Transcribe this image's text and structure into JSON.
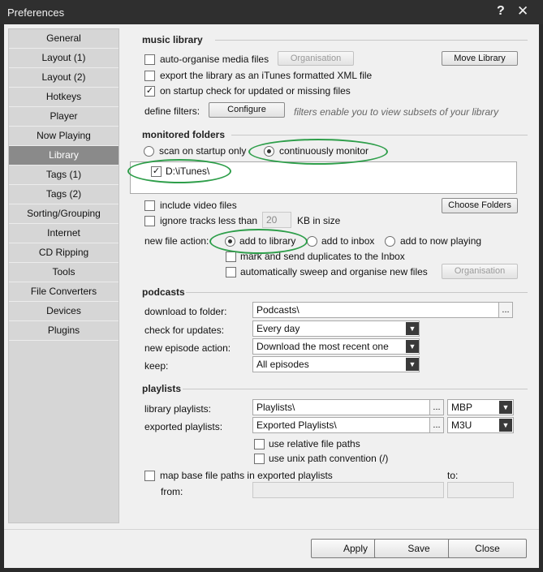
{
  "window": {
    "title": "Preferences",
    "help_glyph": "?",
    "close_glyph": "✕"
  },
  "nav": {
    "items": [
      "General",
      "Layout (1)",
      "Layout (2)",
      "Hotkeys",
      "Player",
      "Now Playing",
      "Library",
      "Tags (1)",
      "Tags (2)",
      "Sorting/Grouping",
      "Internet",
      "CD Ripping",
      "Tools",
      "File Converters",
      "Devices",
      "Plugins"
    ],
    "selected": "Library"
  },
  "music_library": {
    "section": "music library",
    "auto_organise": {
      "label": "auto-organise media files",
      "checked": false
    },
    "organisation_button": "Organisation",
    "move_library_button": "Move Library",
    "export_itunes": {
      "label": "export the library as an iTunes formatted XML file",
      "checked": false
    },
    "startup_check": {
      "label": "on startup check for updated or missing files",
      "checked": true
    },
    "define_filters_label": "define filters:",
    "configure_button": "Configure",
    "filters_hint": "filters enable you to view subsets of your library"
  },
  "monitored": {
    "section": "monitored folders",
    "scan_startup": "scan on startup only",
    "continuous": "continuously monitor",
    "folders": [
      {
        "path": "D:\\iTunes\\",
        "checked": true
      }
    ],
    "include_video": "include video files",
    "choose_folders_button": "Choose Folders",
    "ignore_tracks": "ignore tracks less than",
    "ignore_value": "20",
    "kb_label": "KB in size",
    "new_file_action_label": "new file action:",
    "add_to_library": "add to library",
    "add_to_inbox": "add to inbox",
    "add_to_now_playing": "add to now playing",
    "mark_duplicates": "mark and send duplicates to the Inbox",
    "auto_sweep": "automatically sweep and organise new files",
    "organisation_button": "Organisation"
  },
  "podcasts": {
    "section": "podcasts",
    "download_label": "download to folder:",
    "download_value": "Podcasts\\",
    "check_label": "check for updates:",
    "check_value": "Every day",
    "episode_label": "new episode action:",
    "episode_value": "Download the most recent one",
    "keep_label": "keep:",
    "keep_value": "All episodes"
  },
  "playlists": {
    "section": "playlists",
    "library_label": "library playlists:",
    "library_path": "Playlists\\",
    "library_format": "MBP",
    "exported_label": "exported playlists:",
    "exported_path": "Exported Playlists\\",
    "exported_format": "M3U",
    "relative_paths": "use relative file paths",
    "unix_paths": "use unix path convention (/)",
    "map_base": "map base file paths in exported playlists",
    "to_label": "to:",
    "from_label": "from:"
  },
  "footer": {
    "apply": "Apply",
    "save": "Save",
    "close": "Close"
  },
  "browse_glyph": "...",
  "dropdown_glyph": "▼",
  "check_glyph": "✓",
  "colors": {
    "selected_nav": "#8a8a8a",
    "highlight_ring": "#2e9e4a",
    "titlebar": "#2f2f2f"
  }
}
